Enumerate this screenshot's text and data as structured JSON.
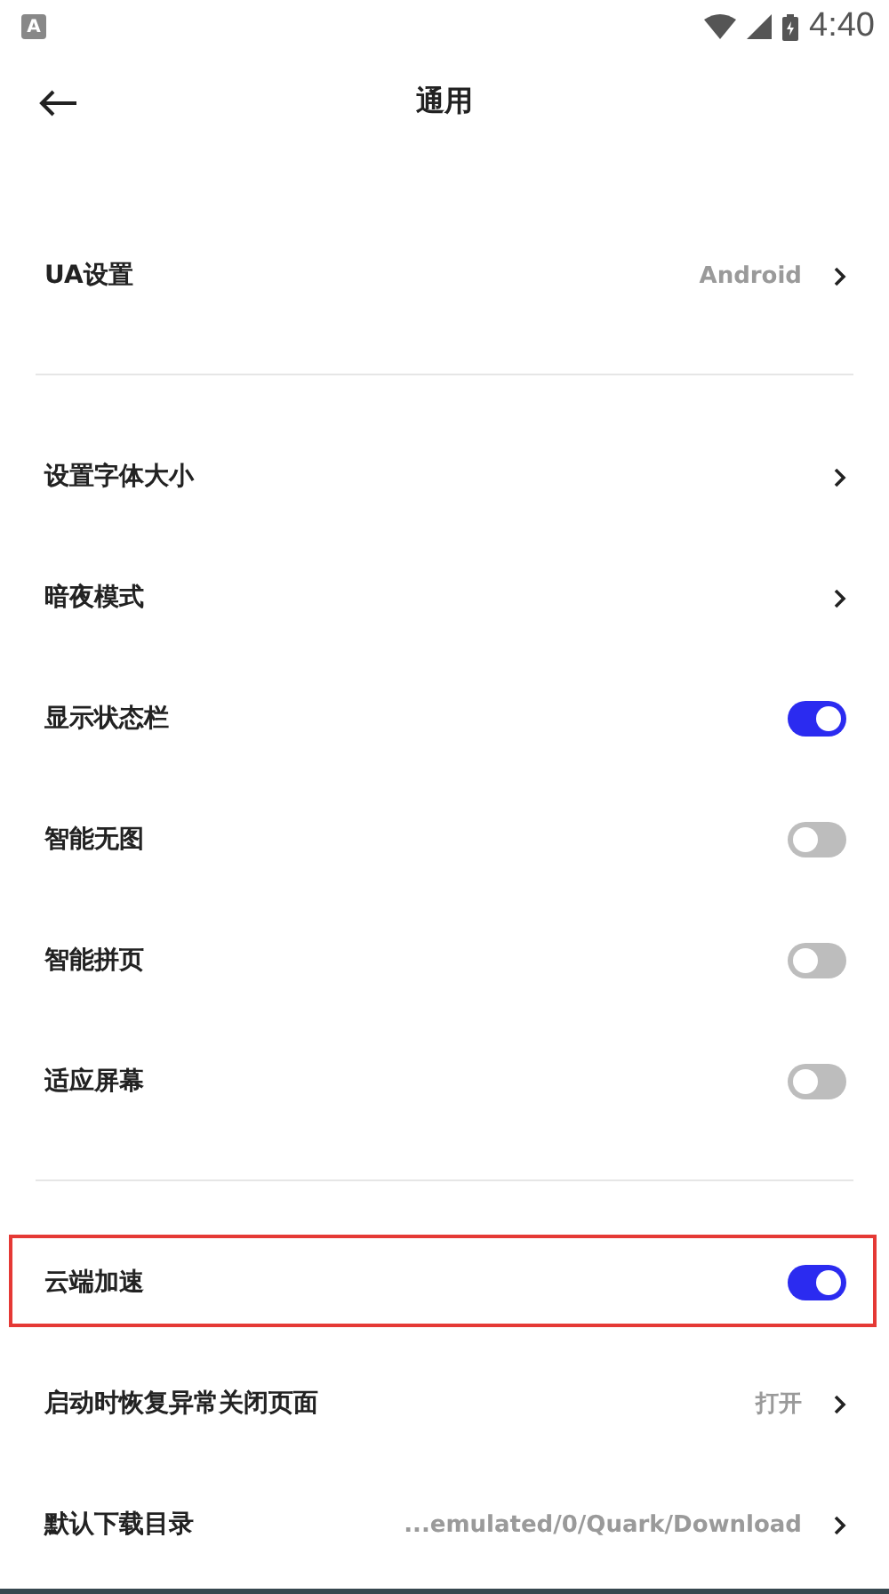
{
  "status_bar": {
    "notification_badge": "A",
    "time": "4:40"
  },
  "header": {
    "title": "通用"
  },
  "sections": [
    {
      "items": [
        {
          "kind": "link",
          "label": "UA设置",
          "value": "Android",
          "highlighted": false
        }
      ]
    },
    {
      "items": [
        {
          "kind": "link",
          "label": "设置字体大小",
          "highlighted": false
        },
        {
          "kind": "link",
          "label": "暗夜模式",
          "highlighted": false
        },
        {
          "kind": "toggle",
          "label": "显示状态栏",
          "on": true,
          "highlighted": false
        },
        {
          "kind": "toggle",
          "label": "智能无图",
          "on": false,
          "highlighted": false
        },
        {
          "kind": "toggle",
          "label": "智能拼页",
          "on": false,
          "highlighted": false
        },
        {
          "kind": "toggle",
          "label": "适应屏幕",
          "on": false,
          "highlighted": false
        }
      ]
    },
    {
      "items": [
        {
          "kind": "toggle",
          "label": "云端加速",
          "on": true,
          "highlighted": true
        },
        {
          "kind": "link",
          "label": "启动时恢复异常关闭页面",
          "value": "打开",
          "highlighted": false
        },
        {
          "kind": "link",
          "label": "默认下载目录",
          "value": "...emulated/0/Quark/Download",
          "highlighted": false
        }
      ]
    }
  ]
}
